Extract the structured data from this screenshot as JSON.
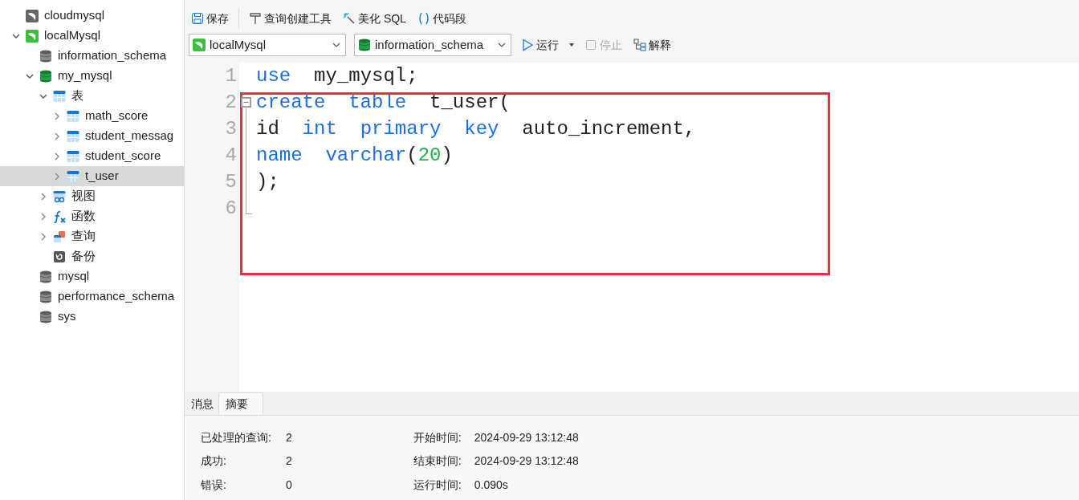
{
  "sidebar": {
    "tree": [
      {
        "label": "cloudmysql",
        "kind": "connection-gray",
        "selected": false,
        "has_children": false
      },
      {
        "label": "localMysql",
        "kind": "connection-green",
        "expanded": true,
        "selected": false,
        "has_children": true,
        "children": [
          {
            "label": "information_schema",
            "kind": "db-gray",
            "selected": false,
            "has_children": false
          },
          {
            "label": "my_mysql",
            "kind": "db-green",
            "expanded": true,
            "selected": false,
            "has_children": true,
            "children": [
              {
                "label": "表",
                "kind": "table",
                "expanded": true,
                "selected": false,
                "has_children": true,
                "children": [
                  {
                    "label": "math_score",
                    "kind": "table",
                    "expanded": false,
                    "selected": false,
                    "has_children": true
                  },
                  {
                    "label": "student_messag",
                    "kind": "table",
                    "expanded": false,
                    "selected": false,
                    "has_children": true
                  },
                  {
                    "label": "student_score",
                    "kind": "table",
                    "expanded": false,
                    "selected": false,
                    "has_children": true
                  },
                  {
                    "label": "t_user",
                    "kind": "table",
                    "expanded": false,
                    "selected": true,
                    "has_children": true
                  }
                ]
              },
              {
                "label": "视图",
                "kind": "view",
                "expanded": false,
                "selected": false,
                "has_children": true
              },
              {
                "label": "函数",
                "kind": "function",
                "expanded": false,
                "selected": false,
                "has_children": true
              },
              {
                "label": "查询",
                "kind": "query",
                "expanded": false,
                "selected": false,
                "has_children": true
              },
              {
                "label": "备份",
                "kind": "backup",
                "selected": false,
                "has_children": false
              }
            ]
          },
          {
            "label": "mysql",
            "kind": "db-gray",
            "selected": false,
            "has_children": false
          },
          {
            "label": "performance_schema",
            "kind": "db-gray",
            "selected": false,
            "has_children": false
          },
          {
            "label": "sys",
            "kind": "db-gray",
            "selected": false,
            "has_children": false
          }
        ]
      }
    ]
  },
  "toolbar": {
    "buttons": [
      {
        "label": "保存",
        "kind": "save",
        "disabled": false
      },
      {
        "label": "查询创建工具",
        "kind": "builder",
        "disabled": false
      },
      {
        "label": "美化 SQL",
        "kind": "beautify",
        "disabled": false
      },
      {
        "label": "代码段",
        "kind": "snippet",
        "disabled": false
      }
    ],
    "connection_select": {
      "value": "localMysql"
    },
    "database_select": {
      "value": "information_schema"
    },
    "actions": [
      {
        "label": "运行",
        "kind": "run",
        "disabled": false,
        "dropdown": true
      },
      {
        "label": "停止",
        "kind": "stop",
        "disabled": true,
        "dropdown": false
      },
      {
        "label": "解释",
        "kind": "explain",
        "disabled": false,
        "dropdown": false
      }
    ]
  },
  "editor": {
    "lines": [
      {
        "number": "1",
        "tokens": [
          {
            "text": "use",
            "kind": "keyword"
          },
          {
            "text": "  my_mysql;",
            "kind": "plain"
          }
        ]
      },
      {
        "number": "2",
        "fold": true,
        "tokens": [
          {
            "text": "create  ",
            "kind": "keyword"
          },
          {
            "text": "table",
            "kind": "keyword"
          },
          {
            "text": "  t_user(",
            "kind": "plain"
          }
        ]
      },
      {
        "number": "3",
        "tokens": [
          {
            "text": "id  ",
            "kind": "plain"
          },
          {
            "text": "int  ",
            "kind": "keyword"
          },
          {
            "text": "primary  ",
            "kind": "keyword"
          },
          {
            "text": "key",
            "kind": "keyword"
          },
          {
            "text": "  auto_increment,",
            "kind": "plain"
          }
        ]
      },
      {
        "number": "4",
        "tokens": [
          {
            "text": "name  ",
            "kind": "keyword"
          },
          {
            "text": "varchar",
            "kind": "keyword"
          },
          {
            "text": "(",
            "kind": "plain"
          },
          {
            "text": "20",
            "kind": "number"
          },
          {
            "text": ")",
            "kind": "plain"
          }
        ]
      },
      {
        "number": "5",
        "tokens": [
          {
            "text": ");",
            "kind": "plain"
          }
        ]
      },
      {
        "number": "6"
      }
    ]
  },
  "result_panel": {
    "tabs": [
      {
        "label": "消息",
        "selected": false
      },
      {
        "label": "摘要",
        "selected": true
      }
    ],
    "summary_left": [
      {
        "label": "已处理的查询:",
        "value": "2"
      },
      {
        "label": "成功:",
        "value": "2"
      },
      {
        "label": "错误:",
        "value": "0"
      }
    ],
    "summary_right": [
      {
        "label": "开始时间:",
        "value": "2024-09-29 13:12:48"
      },
      {
        "label": "结束时间:",
        "value": "2024-09-29 13:12:48"
      },
      {
        "label": "运行时间:",
        "value": "0.090s"
      }
    ]
  }
}
